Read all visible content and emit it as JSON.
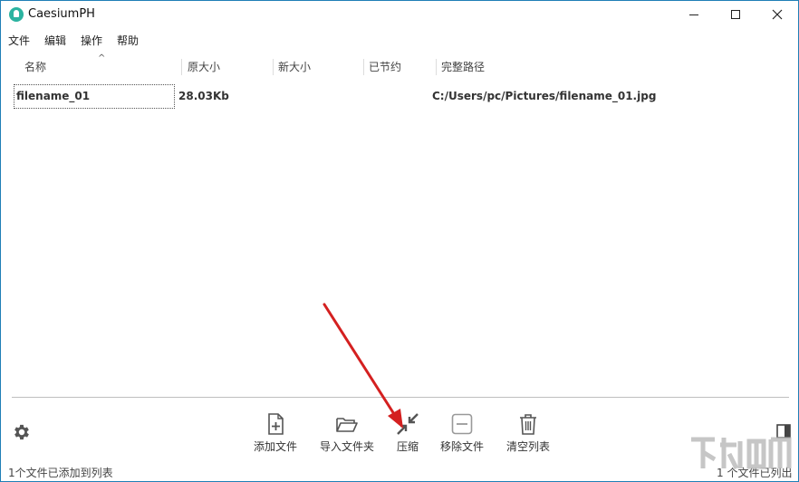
{
  "window": {
    "title": "CaesiumPH"
  },
  "menu": [
    "文件",
    "编辑",
    "操作",
    "帮助"
  ],
  "columns": {
    "name": "名称",
    "original_size": "原大小",
    "new_size": "新大小",
    "saved": "已节约",
    "full_path": "完整路径"
  },
  "rows": [
    {
      "name": "filename_01",
      "original_size": "28.03Kb",
      "new_size": "",
      "saved": "",
      "full_path": "C:/Users/pc/Pictures/filename_01.jpg"
    }
  ],
  "toolbar": {
    "add_file": "添加文件",
    "import_folder": "导入文件夹",
    "compress": "压缩",
    "remove_file": "移除文件",
    "clear_list": "清空列表"
  },
  "status": {
    "left": "1个文件已添加到列表",
    "right": "1 个文件已列出"
  },
  "colors": {
    "window_border": "#1f7fb6",
    "app_icon": "#2bb3a0",
    "annotation_arrow": "#d42020"
  }
}
